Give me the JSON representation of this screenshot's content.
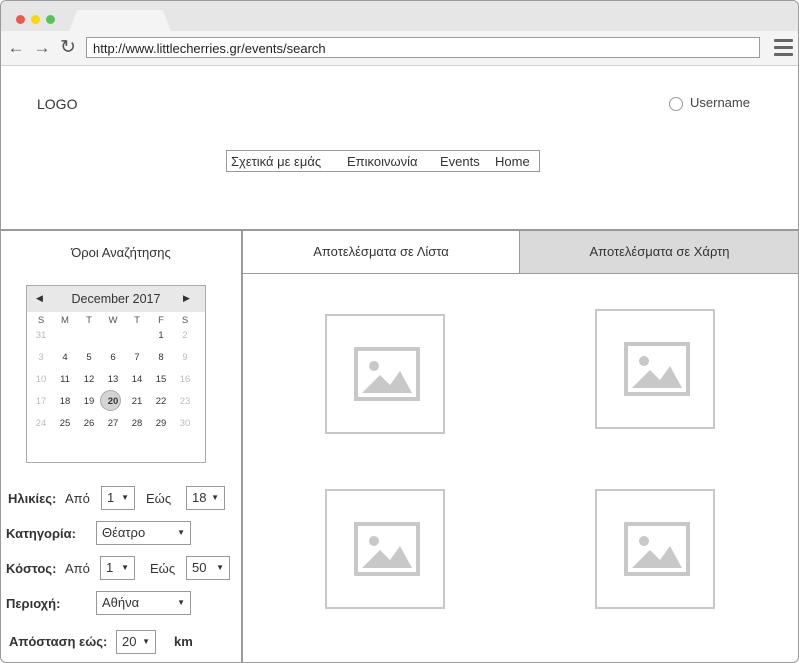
{
  "browser": {
    "url": "http://www.littlecherries.gr/events/search",
    "dot_colors": [
      "#ed594a",
      "#fdd800",
      "#5ac05a"
    ]
  },
  "header": {
    "logo": "LOGO",
    "username": "Username",
    "menu": [
      "Σχετικά με εμάς",
      "Επικοινωνία",
      "Events",
      "Home"
    ]
  },
  "search": {
    "title": "Όροι Αναζήτησης",
    "calendar": {
      "month": "December 2017",
      "weekdays": [
        "S",
        "M",
        "T",
        "W",
        "T",
        "F",
        "S"
      ],
      "weeks": [
        [
          "31",
          "",
          "",
          "",
          "",
          "1",
          "2"
        ],
        [
          "3",
          "4",
          "5",
          "6",
          "7",
          "8",
          "9"
        ],
        [
          "10",
          "11",
          "12",
          "13",
          "14",
          "15",
          "16"
        ],
        [
          "17",
          "18",
          "19",
          "20",
          "21",
          "22",
          "23"
        ],
        [
          "24",
          "25",
          "26",
          "27",
          "28",
          "29",
          "30"
        ]
      ],
      "selected": "20"
    },
    "ages": {
      "label": "Ηλικίες:",
      "from_label": "Από",
      "from": "1",
      "to_label": "Εώς",
      "to": "18"
    },
    "category": {
      "label": "Κατηγορία:",
      "value": "Θέατρο"
    },
    "cost": {
      "label": "Κόστος:",
      "from_label": "Από",
      "from": "1",
      "to_label": "Εώς",
      "to": "50"
    },
    "area": {
      "label": "Περιοχή:",
      "value": "Αθήνα"
    },
    "distance": {
      "label": "Απόσταση εώς:",
      "value": "20",
      "unit": "km"
    }
  },
  "results": {
    "tab_list": "Αποτελέσματα σε Λίστα",
    "tab_map": "Αποτελέσματα σε Χάρτη",
    "image_count": 4
  }
}
